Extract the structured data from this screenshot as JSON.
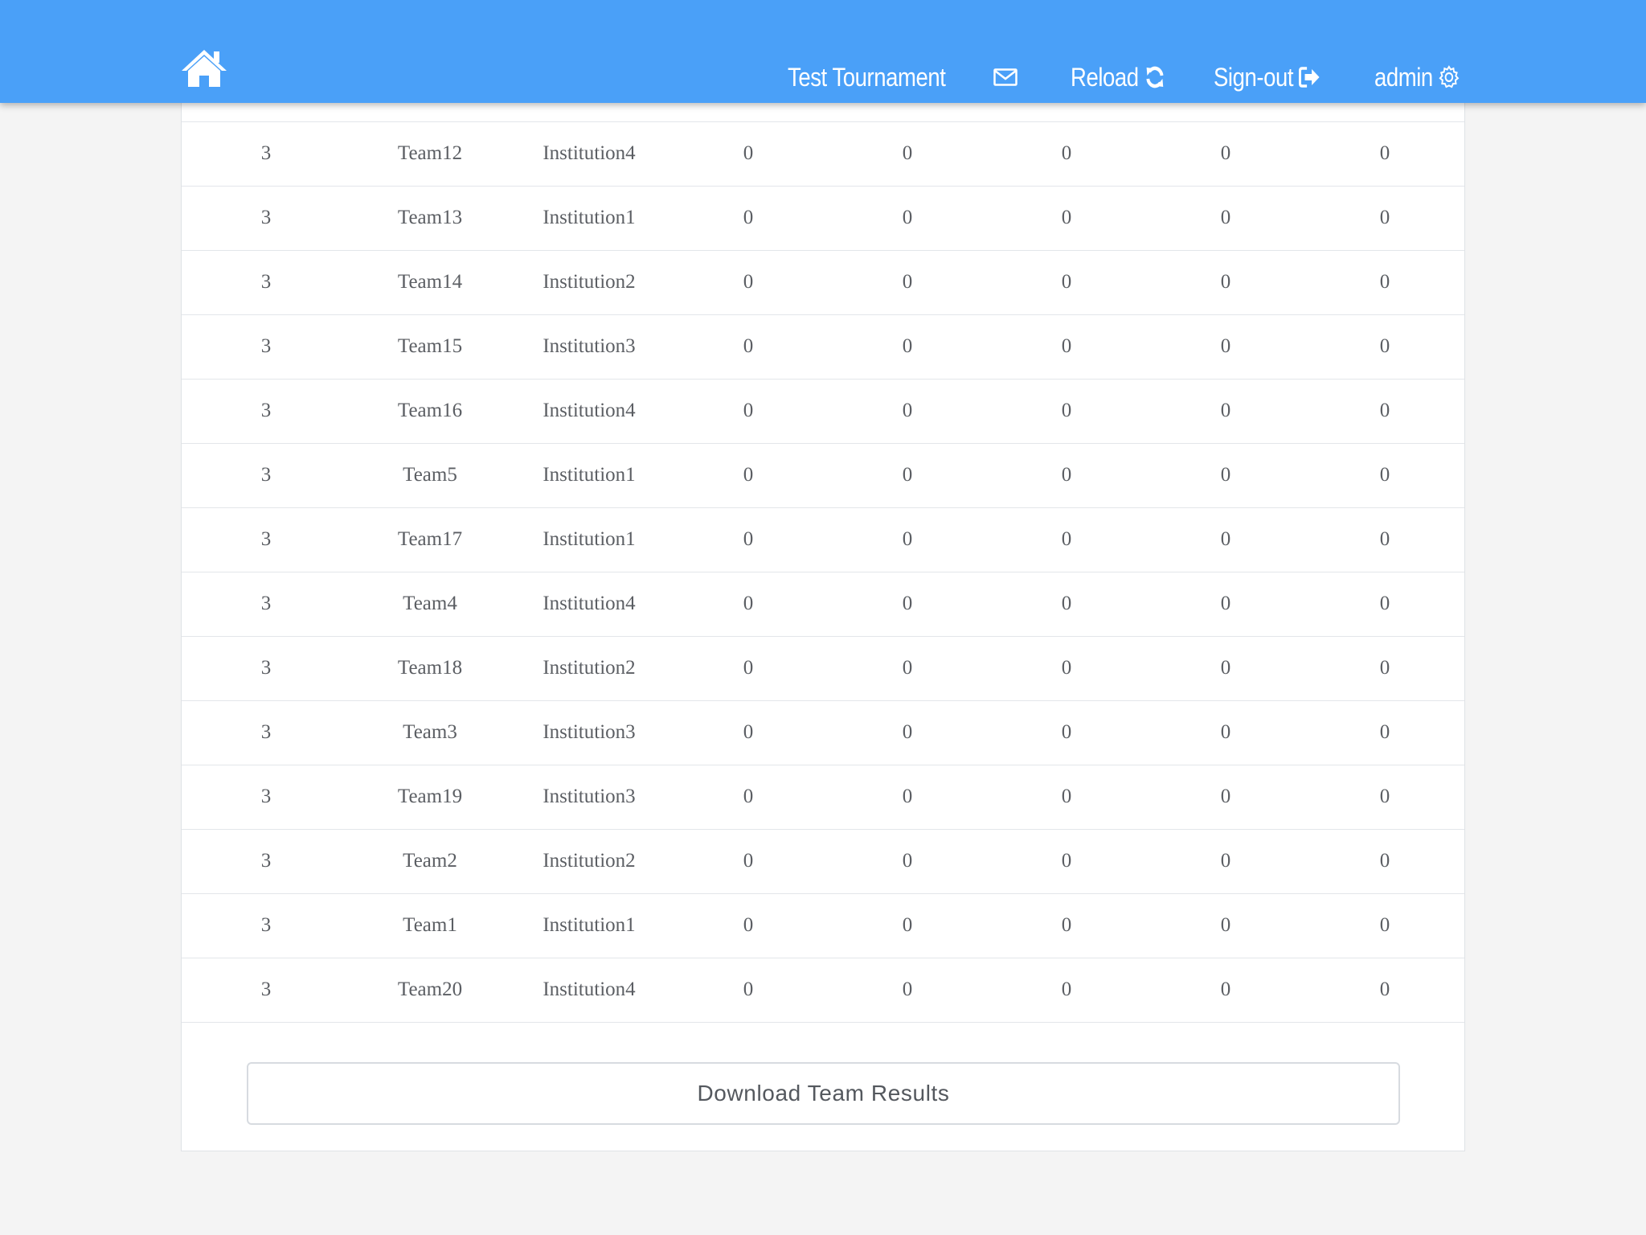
{
  "colors": {
    "navbar": "#4aa0f8",
    "page_background": "#f4f4f4",
    "text": "#5b5e63",
    "row_border": "#e3e6ea"
  },
  "nav": {
    "home_icon": "home-icon",
    "tournament": "Test Tournament",
    "mail_icon": "mail-icon",
    "reload": "Reload",
    "reload_icon": "refresh-icon",
    "signout": "Sign-out",
    "signout_icon": "sign-out-icon",
    "admin": "admin",
    "admin_icon": "gear-icon"
  },
  "results_table": {
    "rows": [
      [
        "3",
        "Team12",
        "Institution4",
        "0",
        "0",
        "0",
        "0",
        "0"
      ],
      [
        "3",
        "Team13",
        "Institution1",
        "0",
        "0",
        "0",
        "0",
        "0"
      ],
      [
        "3",
        "Team14",
        "Institution2",
        "0",
        "0",
        "0",
        "0",
        "0"
      ],
      [
        "3",
        "Team15",
        "Institution3",
        "0",
        "0",
        "0",
        "0",
        "0"
      ],
      [
        "3",
        "Team16",
        "Institution4",
        "0",
        "0",
        "0",
        "0",
        "0"
      ],
      [
        "3",
        "Team5",
        "Institution1",
        "0",
        "0",
        "0",
        "0",
        "0"
      ],
      [
        "3",
        "Team17",
        "Institution1",
        "0",
        "0",
        "0",
        "0",
        "0"
      ],
      [
        "3",
        "Team4",
        "Institution4",
        "0",
        "0",
        "0",
        "0",
        "0"
      ],
      [
        "3",
        "Team18",
        "Institution2",
        "0",
        "0",
        "0",
        "0",
        "0"
      ],
      [
        "3",
        "Team3",
        "Institution3",
        "0",
        "0",
        "0",
        "0",
        "0"
      ],
      [
        "3",
        "Team19",
        "Institution3",
        "0",
        "0",
        "0",
        "0",
        "0"
      ],
      [
        "3",
        "Team2",
        "Institution2",
        "0",
        "0",
        "0",
        "0",
        "0"
      ],
      [
        "3",
        "Team1",
        "Institution1",
        "0",
        "0",
        "0",
        "0",
        "0"
      ],
      [
        "3",
        "Team20",
        "Institution4",
        "0",
        "0",
        "0",
        "0",
        "0"
      ]
    ]
  },
  "download_button": "Download Team Results"
}
